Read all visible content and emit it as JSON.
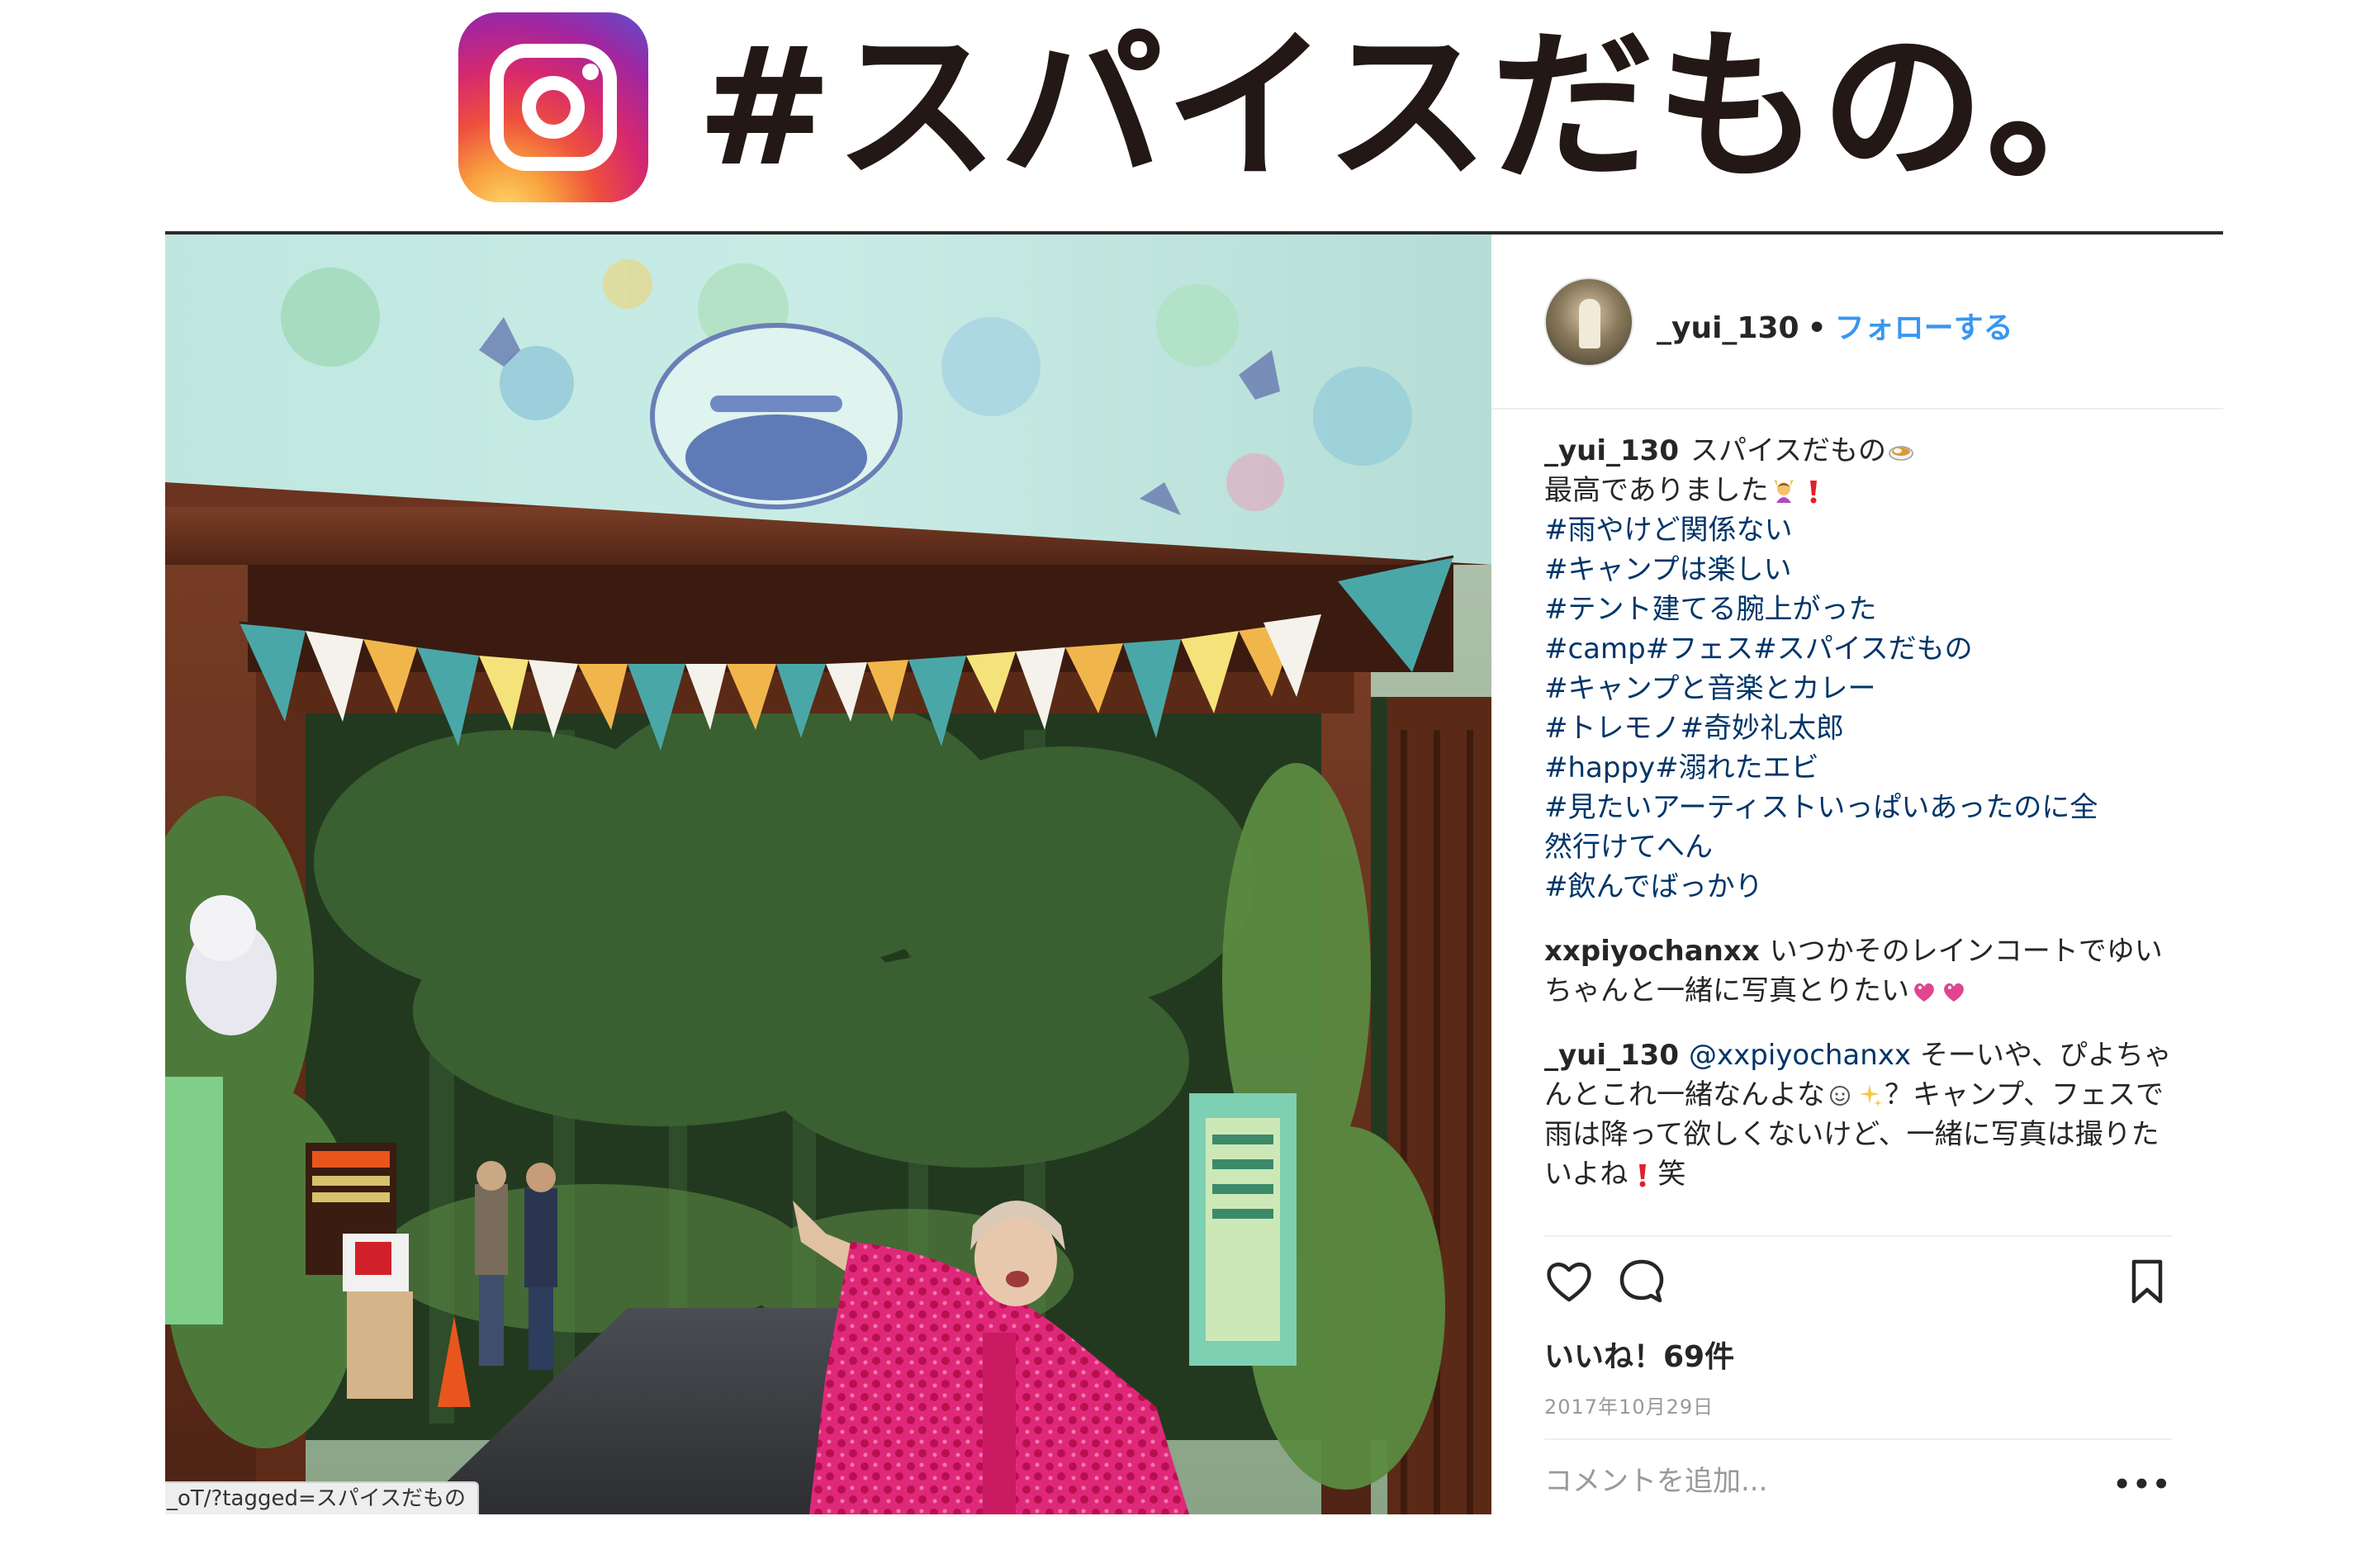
{
  "title": {
    "hashtag_text": "#スパイスだもの。"
  },
  "post": {
    "status_url": "_oT/?tagged=スパイスだもの",
    "author": {
      "username": "_yui_130",
      "separator": "•",
      "follow_label": "フォローする"
    },
    "caption": {
      "username": "_yui_130",
      "first_line_text": "スパイスだもの",
      "second_line_text": "最高でありました",
      "hashtag_lines": [
        "#雨やけど関係ない",
        "#キャンプは楽しい",
        "#テント建てる腕上がった",
        "#camp#フェス#スパイスだもの",
        "#キャンプと音楽とカレー",
        "#トレモノ#奇妙礼太郎",
        "#happy#溺れたエビ",
        "#見たいアーティストいっぱいあったのに全",
        "然行けてへん",
        "#飲んでばっかり"
      ]
    },
    "comments": [
      {
        "username": "xxpiyochanxx",
        "text": "いつかそのレインコートでゆいちゃんと一緒に写真とりたい"
      },
      {
        "username": "_yui_130",
        "mention": "@xxpiyochanxx",
        "text_before_emoji": "そーいや、ぴよちゃんとこれ一緒なんよな",
        "text_after_emoji": "？キャンプ、フェスで雨は降って欲しくないけど、一緒に写真は撮りたいよね",
        "text_end": "笑"
      }
    ],
    "actions": {
      "like_icon": "heart-icon",
      "comment_icon": "speech-bubble-icon",
      "save_icon": "bookmark-icon"
    },
    "likes_text": "いいね！69件",
    "date_text": "2017年10月29日",
    "add_comment_placeholder": "コメントを追加...",
    "more_label": "•••"
  },
  "colors": {
    "link_blue": "#3897f0",
    "hashtag_navy": "#003569",
    "text": "#262626",
    "muted": "#999999"
  }
}
